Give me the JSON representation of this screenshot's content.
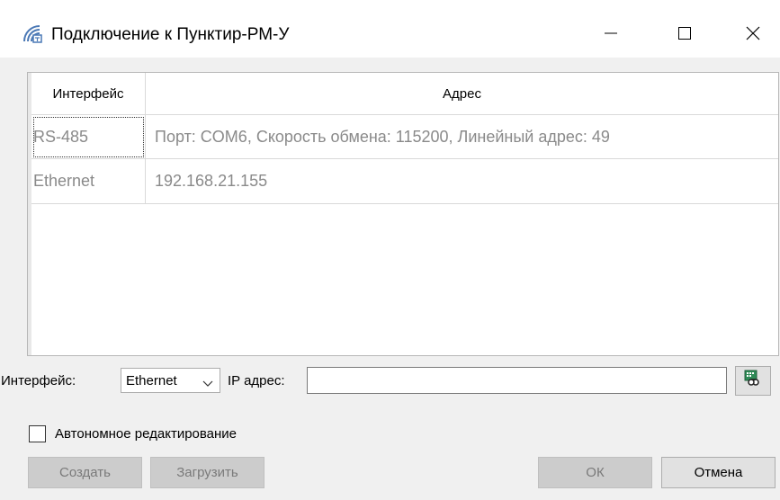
{
  "window": {
    "title": "Подключение к Пунктир-РМ-У",
    "icon": "signal-antenna-icon",
    "controls": [
      "minimize-icon",
      "maximize-icon",
      "close-icon"
    ]
  },
  "table": {
    "columns": [
      "Интерфейс",
      "Адрес"
    ],
    "rows": [
      {
        "interface": "RS-485",
        "address": "Порт: COM6, Скорость обмена: 115200, Линейный адрес: 49"
      },
      {
        "interface": "Ethernet",
        "address": "192.168.21.155"
      }
    ]
  },
  "form": {
    "interface_label": "Интерфейс:",
    "interface_value": "Ethernet",
    "ip_label": "IP адрес:",
    "ip_value": "",
    "scan_icon": "network-scan-icon"
  },
  "offline_edit": {
    "label": "Автономное редактирование",
    "checked": false
  },
  "buttons": {
    "create": "Создать",
    "load": "Загрузить",
    "ok": "ОК",
    "cancel": "Отмена"
  }
}
